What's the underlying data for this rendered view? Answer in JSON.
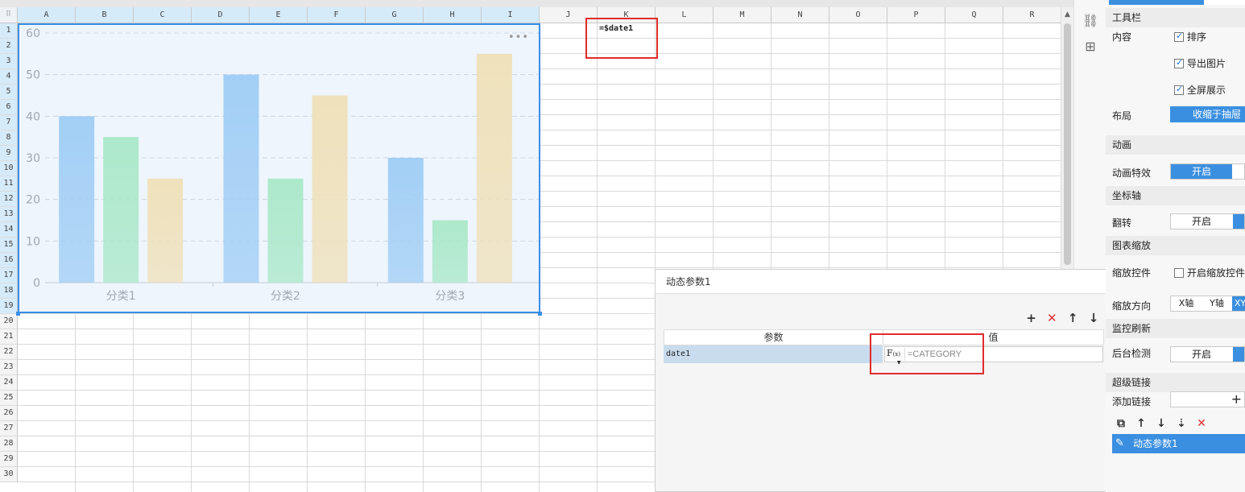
{
  "sheet": {
    "columns": [
      "A",
      "B",
      "C",
      "D",
      "E",
      "F",
      "G",
      "H",
      "I",
      "J",
      "K",
      "L",
      "M",
      "N",
      "O",
      "P",
      "Q",
      "R"
    ],
    "selected_columns": [
      "A",
      "B",
      "C",
      "D",
      "E",
      "F",
      "G",
      "H",
      "I"
    ],
    "rows": [
      "1",
      "2",
      "3",
      "4",
      "5",
      "6",
      "7",
      "8",
      "9",
      "10",
      "11",
      "12",
      "13",
      "14",
      "15",
      "16",
      "17",
      "18",
      "19",
      "20",
      "21",
      "22",
      "23",
      "24",
      "25",
      "26",
      "27",
      "28",
      "29",
      "30"
    ],
    "selected_rows_count": 19,
    "corner_glyph": "⠿",
    "cell_k1": "=$date1"
  },
  "chart_data": {
    "type": "bar",
    "categories": [
      "分类1",
      "分类2",
      "分类3"
    ],
    "series": [
      {
        "values": [
          40,
          50,
          30
        ],
        "color": "#9fcdf5"
      },
      {
        "values": [
          35,
          25,
          15
        ],
        "color": "#a9e8c8"
      },
      {
        "values": [
          25,
          45,
          55
        ],
        "color": "#efe0b8"
      }
    ],
    "y_ticks": [
      "0",
      "10",
      "20",
      "30",
      "40",
      "50",
      "60"
    ],
    "ylim": [
      0,
      60
    ],
    "grid": true,
    "more_glyph": "•••"
  },
  "icons": {
    "link": "⛓",
    "tree": "⊞"
  },
  "param_panel": {
    "title": "动态参数1",
    "toolbar": {
      "add": "+",
      "delete": "✕",
      "up": "↑",
      "down": "↓"
    },
    "headers": {
      "param": "参数",
      "value": "值"
    },
    "row": {
      "name": "date1",
      "fx_label": "F",
      "fx_sub": "(x)",
      "value": "=CATEGORY"
    }
  },
  "props": {
    "toolbar_section": "工具栏",
    "content_label": "内容",
    "sort": "排序",
    "export_image": "导出图片",
    "fullscreen": "全屏展示",
    "layout_label": "布局",
    "layout_value": "收缩于抽屉",
    "animation_section": "动画",
    "animation_effect_label": "动画特效",
    "animation_on": "开启",
    "axis_section": "坐标轴",
    "flip_label": "翻转",
    "flip_on": "开启",
    "zoom_section": "图表缩放",
    "zoom_control_label": "缩放控件",
    "zoom_control_check": "开启缩放控件",
    "zoom_direction_label": "缩放方向",
    "zoom_x": "X轴",
    "zoom_y": "Y轴",
    "zoom_xy": "XY",
    "monitor_section": "监控刷新",
    "backend_label": "后台检测",
    "backend_on": "开启",
    "hyperlink_section": "超级链接",
    "add_link_label": "添加链接",
    "add_glyph": "+",
    "link_toolbar": {
      "copy": "⧉",
      "up": "↑",
      "down": "↓",
      "move": "⇣",
      "delete": "✕"
    },
    "link_item": "动态参数1",
    "edit_glyph": "✎"
  },
  "colors": {
    "accent": "#3b8fe0",
    "chart_border": "#3a8ee6",
    "highlight": "#e02b2b",
    "delete": "#e03030"
  }
}
